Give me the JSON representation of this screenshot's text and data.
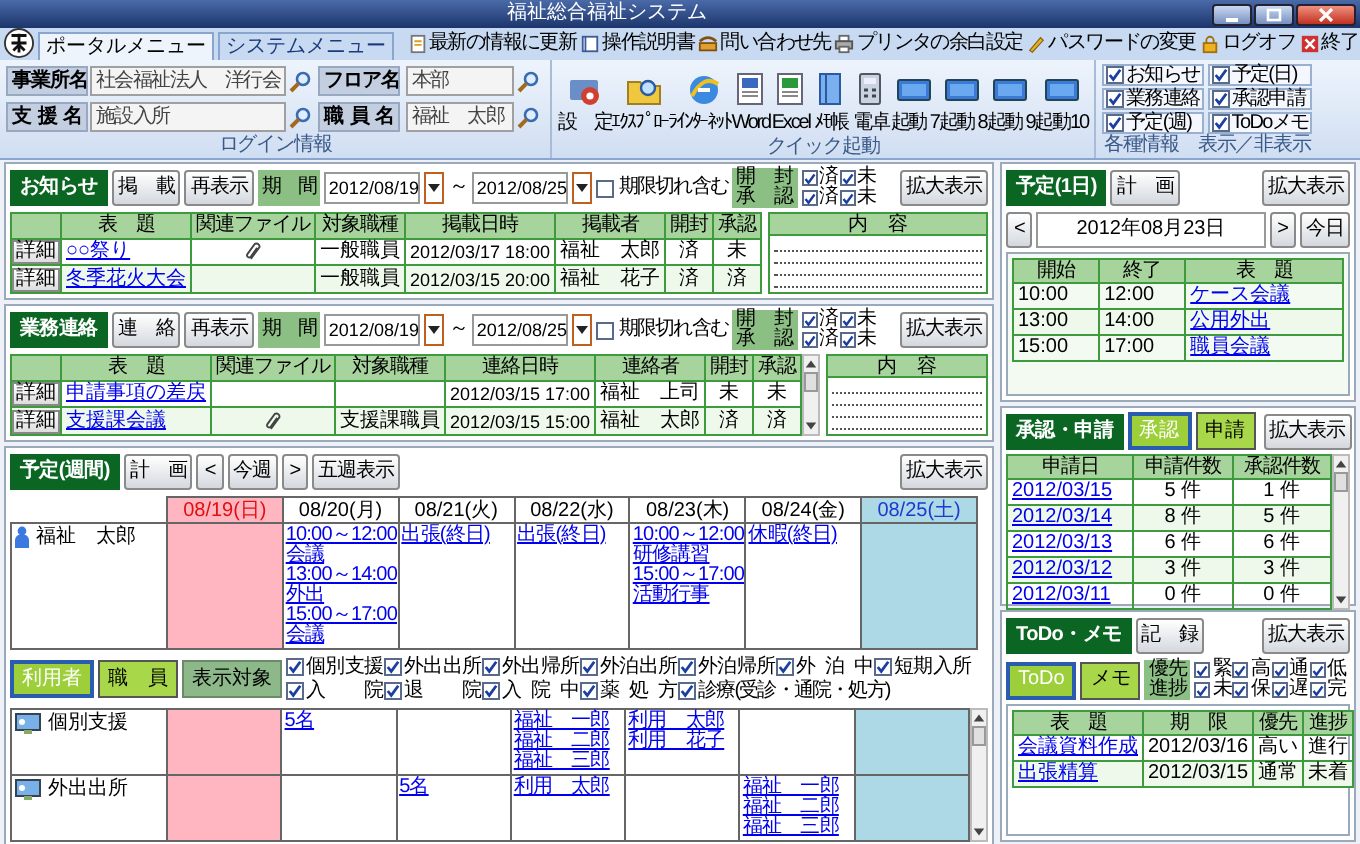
{
  "window": {
    "title": "福祉総合福祉システム"
  },
  "tabs": [
    {
      "label": "ポータルメニュー",
      "selected": true
    },
    {
      "label": "システムメニュー",
      "selected": false
    }
  ],
  "links": [
    "最新の情報に更新",
    "操作説明書",
    "問い合わせ先",
    "プリンタの余白設定",
    "パスワードの変更",
    "ログオフ",
    "終了"
  ],
  "login": {
    "fields": [
      {
        "label": "事業所名",
        "value": "社会福祉法人　洋行会"
      },
      {
        "label": "フロア名",
        "value": "本部"
      },
      {
        "label": "支援名",
        "value": "施設入所"
      },
      {
        "label": "職員名",
        "value": "福祉　太郎"
      }
    ],
    "caption": "ログイン情報"
  },
  "quick_launch": {
    "items": [
      "設　定",
      "ｴｸｽﾌﾟﾛｰﾗ",
      "ｲﾝﾀｰﾈｯﾄ",
      "Word",
      "Excel",
      "ﾒﾓ帳",
      "電卓",
      "起動 7",
      "起動 8",
      "起動 9",
      "起動10"
    ],
    "caption": "クイック起動"
  },
  "display": {
    "items": [
      {
        "label": "お知らせ",
        "checked": true
      },
      {
        "label": "予定(日)",
        "checked": true
      },
      {
        "label": "業務連絡",
        "checked": true
      },
      {
        "label": "承認申請",
        "checked": true
      },
      {
        "label": "予定(週)",
        "checked": true
      },
      {
        "label": "ToDoメモ",
        "checked": true
      }
    ],
    "caption": "各種情報　表示／非表示"
  },
  "notices": {
    "title": "お知らせ",
    "buttons": [
      "掲　載",
      "再表示"
    ],
    "period_label": "期　間",
    "date_from": "2012/08/19",
    "separator": "～",
    "date_to": "2012/08/25",
    "include_expired": {
      "label": "期限切れ含む",
      "checked": false
    },
    "filters": [
      {
        "label": "開　封",
        "options": [
          {
            "label": "済",
            "checked": true
          },
          {
            "label": "未",
            "checked": true
          }
        ]
      },
      {
        "label": "承　認",
        "options": [
          {
            "label": "済",
            "checked": true
          },
          {
            "label": "未",
            "checked": true
          }
        ]
      }
    ],
    "expand": "拡大表示",
    "columns": [
      "表　題",
      "関連ファイル",
      "対象職種",
      "掲載日時",
      "掲載者",
      "開封",
      "承認"
    ],
    "rows": [
      {
        "detail": "詳細",
        "title": "○○祭り",
        "attachment": true,
        "target": "一般職員",
        "datetime": "2012/03/17 18:00",
        "author": "福祉　太郎",
        "opened": "済",
        "approved": "未"
      },
      {
        "detail": "詳細",
        "title": "冬季花火大会",
        "attachment": false,
        "target": "一般職員",
        "datetime": "2012/03/15 20:00",
        "author": "福祉　花子",
        "opened": "済",
        "approved": "済"
      }
    ],
    "content_label": "内　容"
  },
  "business_contacts": {
    "title": "業務連絡",
    "buttons": [
      "連　絡",
      "再表示"
    ],
    "period_label": "期　間",
    "date_from": "2012/08/19",
    "separator": "～",
    "date_to": "2012/08/25",
    "include_expired": {
      "label": "期限切れ含む",
      "checked": false
    },
    "filters": [
      {
        "label": "開　封",
        "options": [
          {
            "label": "済",
            "checked": true
          },
          {
            "label": "未",
            "checked": true
          }
        ]
      },
      {
        "label": "承　認",
        "options": [
          {
            "label": "済",
            "checked": true
          },
          {
            "label": "未",
            "checked": true
          }
        ]
      }
    ],
    "expand": "拡大表示",
    "columns": [
      "表　題",
      "関連ファイル",
      "対象職種",
      "連絡日時",
      "連絡者",
      "開封",
      "承認"
    ],
    "rows": [
      {
        "detail": "詳細",
        "title": "申請事項の差戻",
        "attachment": false,
        "datetime": "2012/03/15 17:00",
        "author": "福祉　上司",
        "opened": "未",
        "approved": "未"
      },
      {
        "detail": "詳細",
        "title": "支援課会議",
        "attachment": true,
        "target": "支援課職員",
        "datetime": "2012/03/15 15:00",
        "author": "福祉　太郎",
        "opened": "済",
        "approved": "済"
      }
    ],
    "content_label": "内　容"
  },
  "week": {
    "title": "予定(週間)",
    "plan": "計　画",
    "prev": "<",
    "current": "今週",
    "next": ">",
    "five_weeks": "五週表示",
    "expand": "拡大表示",
    "days": [
      {
        "label": "08/19(日)",
        "kind": "sunday"
      },
      {
        "label": "08/20(月)",
        "kind": "weekday"
      },
      {
        "label": "08/21(火)",
        "kind": "weekday"
      },
      {
        "label": "08/22(水)",
        "kind": "weekday"
      },
      {
        "label": "08/23(木)",
        "kind": "weekday"
      },
      {
        "label": "08/24(金)",
        "kind": "weekday"
      },
      {
        "label": "08/25(土)",
        "kind": "saturday"
      }
    ],
    "person": {
      "name": "福祉　太郎",
      "days": [
        {
          "kind": "sunday"
        },
        {
          "kind": "weekday",
          "lines": [
            "10:00～12:00",
            "会議",
            "13:00～14:00",
            "外出",
            "15:00～17:00",
            "会議"
          ]
        },
        {
          "kind": "weekday",
          "lines": [
            "出張(終日)"
          ]
        },
        {
          "kind": "weekday",
          "lines": [
            "出張(終日)"
          ]
        },
        {
          "kind": "weekday",
          "lines": [
            "10:00～12:00",
            "研修講習",
            "15:00～17:00",
            "活動行事"
          ]
        },
        {
          "kind": "weekday",
          "lines": [
            "休暇(終日)"
          ]
        },
        {
          "kind": "saturday"
        }
      ]
    },
    "target_toggles": [
      {
        "label": "利用者",
        "selected": true
      },
      {
        "label": "職　員",
        "selected": false
      }
    ],
    "target_label": "表示対象",
    "categories": [
      [
        {
          "label": "個別支援",
          "checked": true
        },
        {
          "label": "外出出所",
          "checked": true
        },
        {
          "label": "外出帰所",
          "checked": true
        },
        {
          "label": "外泊出所",
          "checked": true
        },
        {
          "label": "外泊帰所",
          "checked": true
        },
        {
          "label": "外泊中",
          "checked": true
        },
        {
          "label": "短期入所",
          "checked": true
        }
      ],
      [
        {
          "label": "入院",
          "checked": true
        },
        {
          "label": "退院",
          "checked": true
        },
        {
          "label": "入院中",
          "checked": true
        },
        {
          "label": "薬処方",
          "checked": true
        },
        {
          "label": "診療(受診・通院・処方)",
          "checked": true
        }
      ]
    ],
    "rows": [
      {
        "label": "個別支援",
        "days": [
          {
            "kind": "sunday"
          },
          {
            "kind": "weekday",
            "lines": [
              "5名"
            ]
          },
          {
            "kind": "weekday"
          },
          {
            "kind": "weekday",
            "lines": [
              "福祉　一郎",
              "福祉　二郎",
              "福祉　三郎"
            ]
          },
          {
            "kind": "weekday",
            "lines": [
              "利用　太郎",
              "利用　花子"
            ]
          },
          {
            "kind": "weekday"
          },
          {
            "kind": "saturday"
          }
        ]
      },
      {
        "label": "外出出所",
        "days": [
          {
            "kind": "sunday"
          },
          {
            "kind": "weekday"
          },
          {
            "kind": "weekday",
            "lines": [
              "5名"
            ]
          },
          {
            "kind": "weekday",
            "lines": [
              "利用　太郎"
            ]
          },
          {
            "kind": "weekday"
          },
          {
            "kind": "weekday",
            "lines": [
              "福祉　一郎",
              "福祉　二郎",
              "福祉　三郎"
            ]
          },
          {
            "kind": "saturday"
          }
        ]
      }
    ]
  },
  "day_schedule": {
    "title": "予定(1日)",
    "plan": "計　画",
    "expand": "拡大表示",
    "prev": "<",
    "date": "2012年08月23日",
    "next": ">",
    "today": "今日",
    "columns": [
      "開始",
      "終了",
      "表　題"
    ],
    "rows": [
      {
        "start": "10:00",
        "end": "12:00",
        "title": "ケース会議"
      },
      {
        "start": "13:00",
        "end": "14:00",
        "title": "公用外出"
      },
      {
        "start": "15:00",
        "end": "17:00",
        "title": "職員会議"
      }
    ]
  },
  "approvals": {
    "title": "承認・申請",
    "toggles": [
      {
        "label": "承認",
        "selected": true
      },
      {
        "label": "申請",
        "selected": false
      }
    ],
    "expand": "拡大表示",
    "columns": [
      "申請日",
      "申請件数",
      "承認件数"
    ],
    "rows": [
      {
        "date": "2012/03/15",
        "requests": "5 件",
        "approvals": "1 件"
      },
      {
        "date": "2012/03/14",
        "requests": "8 件",
        "approvals": "5 件"
      },
      {
        "date": "2012/03/13",
        "requests": "6 件",
        "approvals": "6 件"
      },
      {
        "date": "2012/03/12",
        "requests": "3 件",
        "approvals": "3 件"
      },
      {
        "date": "2012/03/11",
        "requests": "0 件",
        "approvals": "0 件"
      }
    ]
  },
  "todo": {
    "title": "ToDo・メモ",
    "record": "記　録",
    "expand": "拡大表示",
    "toggles": [
      {
        "label": "ToDo",
        "selected": true
      },
      {
        "label": "メモ",
        "selected": false
      }
    ],
    "filters": [
      {
        "label": "優先",
        "options": [
          {
            "label": "緊",
            "checked": true
          },
          {
            "label": "高",
            "checked": true
          },
          {
            "label": "通",
            "checked": true
          },
          {
            "label": "低",
            "checked": true
          }
        ]
      },
      {
        "label": "進捗",
        "options": [
          {
            "label": "未",
            "checked": true
          },
          {
            "label": "保",
            "checked": true
          },
          {
            "label": "遅",
            "checked": true
          },
          {
            "label": "完",
            "checked": true
          }
        ]
      }
    ],
    "columns": [
      "表　題",
      "期　限",
      "優先",
      "進捗"
    ],
    "rows": [
      {
        "title": "会議資料作成",
        "deadline": "2012/03/16",
        "priority": "高い",
        "progress": "進行"
      },
      {
        "title": "出張精算",
        "deadline": "2012/03/15",
        "priority": "通常",
        "progress": "未着"
      }
    ]
  }
}
